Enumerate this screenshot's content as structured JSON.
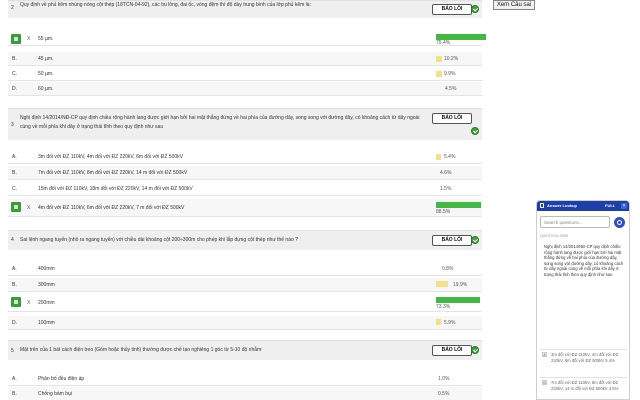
{
  "floating_button": "Xem Câu sai",
  "report_label": "BÁO LỖI",
  "questions": [
    {
      "number": "2",
      "text": "Quy định về phủ kẽm nhúng nóng cột thép (18TCN-04-92), các bu lông, đai ốc, vòng đệm thì độ dày trung bình của lớp phủ kẽm là:",
      "options": [
        {
          "letter": "A.",
          "mark": "X",
          "text": "55 µm.",
          "percent": "75.4%",
          "value": 75.4,
          "correct": true
        },
        {
          "letter": "B.",
          "mark": "",
          "text": "45 µm.",
          "percent": "10.2%",
          "value": 10.2,
          "correct": false
        },
        {
          "letter": "C.",
          "mark": "",
          "text": "50 µm.",
          "percent": "9.9%",
          "value": 9.9,
          "correct": false
        },
        {
          "letter": "D.",
          "mark": "",
          "text": "60 µm.",
          "percent": "4.5%",
          "value": 4.5,
          "correct": false
        }
      ]
    },
    {
      "number": "3",
      "text": "Nghị định 14/2014/NĐ-CP quy định chiều rộng hành lang được giới hạn bởi hai mặt thẳng đứng về hai phía của đường dây, song song với đường dây, có khoảng cách từ dây ngoài cùng về mỗi phía khi dây ở trạng thái tĩnh theo quy định như sau",
      "options": [
        {
          "letter": "A.",
          "mark": "",
          "text": "3m đối với ĐZ 110kV, 4m đối với ĐZ 220kV, 6m đối với ĐZ 500kV",
          "percent": "5.4%",
          "value": 5.4,
          "correct": false
        },
        {
          "letter": "B.",
          "mark": "",
          "text": "7m đối với ĐZ 110kV, 8m đối với ĐZ 220kV, 14 m đối với ĐZ 500kV",
          "percent": "4.6%",
          "value": 4.6,
          "correct": false
        },
        {
          "letter": "C.",
          "mark": "",
          "text": "15m đối với ĐZ 110kV, 18m đối với ĐZ 220kV, 14 m đối với ĐZ 500kV",
          "percent": "1.5%",
          "value": 1.5,
          "correct": false
        },
        {
          "letter": "D.",
          "mark": "X",
          "text": "4m đối với ĐZ 110kV, 6m đối với ĐZ 220kV, 7 m đối với ĐZ 500kV",
          "percent": "88.5%",
          "value": 88.5,
          "correct": true
        }
      ]
    },
    {
      "number": "4",
      "text": "Sai lệnh ngang tuyến (nhô ra ngang tuyến) với chiều dài khoảng cột 200÷300m cho phép khi lắp dựng cột thép như thế nào ?",
      "options": [
        {
          "letter": "A.",
          "mark": "",
          "text": "400mm",
          "percent": "0.8%",
          "value": 0.8,
          "correct": false
        },
        {
          "letter": "B.",
          "mark": "",
          "text": "300mm",
          "percent": "19.9%",
          "value": 19.9,
          "correct": false
        },
        {
          "letter": "C.",
          "mark": "X",
          "text": "200mm",
          "percent": "73.3%",
          "value": 73.3,
          "correct": true
        },
        {
          "letter": "D.",
          "mark": "",
          "text": "100mm",
          "percent": "5.9%",
          "value": 5.9,
          "correct": false
        }
      ]
    },
    {
      "number": "5",
      "text": "Mặt trên của 1 bát cách điện treo (Gốm hoặc thủy tinh) thường được chế tạo nghiêng 1 góc từ 5-10 độ nhằm:",
      "options": [
        {
          "letter": "A.",
          "mark": "",
          "text": "Phân bố đều điện áp",
          "percent": "1.0%",
          "value": 1.0,
          "correct": false
        },
        {
          "letter": "B.",
          "mark": "",
          "text": "Chống bám bụi",
          "percent": "0.5%",
          "value": 0.5,
          "correct": false
        }
      ]
    }
  ],
  "panel": {
    "title": "Answer Lookup",
    "full_label": "FULL",
    "close_label": "×",
    "search_placeholder": "Search questions...",
    "question_id": "QUESTION 3998",
    "question_text": "Nghị định 14/2014/NĐ-CP quy định chiều rộng hành lang được giới hạn bởi hai mặt thẳng đứng về hai phía của đường dây, song song với đường dây, có khoảng cách từ dây ngoài cùng về mỗi phía khi dây ở trạng thái tĩnh theo quy định như sau",
    "answers": [
      {
        "letter": "A",
        "text": "3m đối với ĐZ 110kV, 4m đối với ĐZ 220kV, 6m đối với ĐZ 500kV 5.4%"
      },
      {
        "letter": "B",
        "text": "7m đối với ĐZ 110kV, 8m đối với ĐZ 220kV, 14 m đối với ĐZ 500kV 4.6%"
      }
    ]
  },
  "colors": {
    "correct": "#3a9b3a",
    "bar_green": "#43b843",
    "bar_yellow": "#f5e08a",
    "panel_header": "#1e3fa8"
  }
}
